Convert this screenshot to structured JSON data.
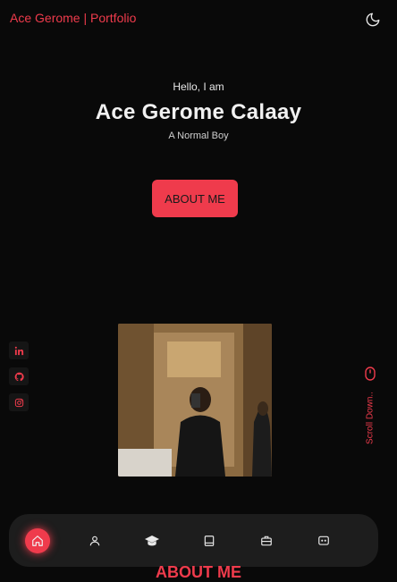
{
  "header": {
    "brand": "Ace Gerome | Portfolio",
    "theme_icon": "moon-icon"
  },
  "hero": {
    "greeting": "Hello, I am",
    "name": "Ace Gerome Calaay",
    "role": "A Normal Boy",
    "cta_label": "ABOUT ME"
  },
  "socials": [
    {
      "icon": "linkedin-icon"
    },
    {
      "icon": "github-icon"
    },
    {
      "icon": "instagram-icon"
    }
  ],
  "scroll": {
    "label": "Scroll Down..",
    "icon": "mouse-icon"
  },
  "nav": {
    "items": [
      {
        "icon": "home-icon",
        "active": true
      },
      {
        "icon": "user-icon",
        "active": false
      },
      {
        "icon": "graduation-cap-icon",
        "active": false
      },
      {
        "icon": "book-icon",
        "active": false
      },
      {
        "icon": "briefcase-icon",
        "active": false
      },
      {
        "icon": "message-icon",
        "active": false
      }
    ]
  },
  "section": {
    "title": "ABOUT ME"
  },
  "colors": {
    "accent": "#ef3b4c",
    "background": "#090909",
    "nav_bg": "#1d1d1d"
  }
}
